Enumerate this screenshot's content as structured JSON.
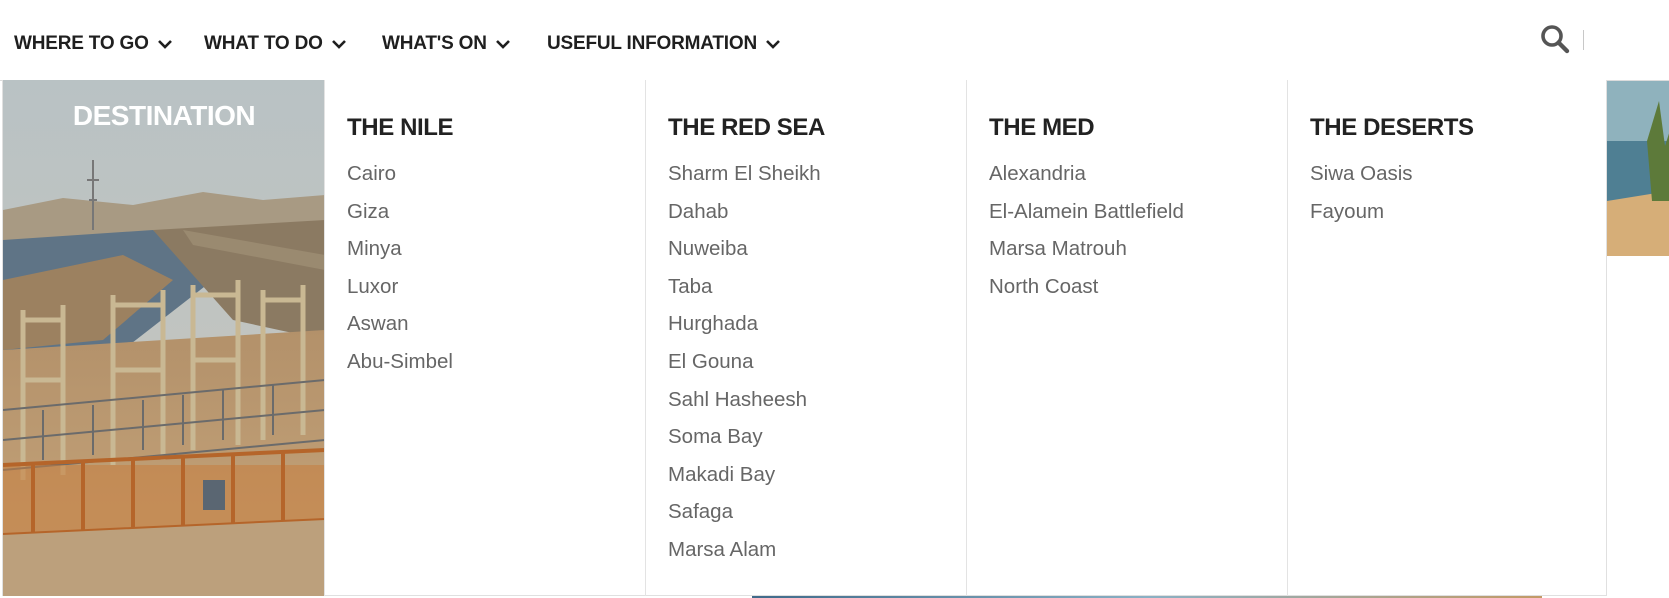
{
  "nav": {
    "items": [
      {
        "label": "WHERE TO GO"
      },
      {
        "label": "WHAT TO DO"
      },
      {
        "label": "WHAT'S ON"
      },
      {
        "label": "USEFUL INFORMATION"
      }
    ],
    "search_icon": "search-icon"
  },
  "menu": {
    "promo": {
      "title": "DESTINATION"
    },
    "columns": [
      {
        "heading": "THE NILE",
        "links": [
          "Cairo",
          "Giza",
          "Minya",
          "Luxor",
          "Aswan",
          "Abu-Simbel"
        ]
      },
      {
        "heading": "THE RED SEA",
        "links": [
          "Sharm El Sheikh",
          "Dahab",
          "Nuweiba",
          "Taba",
          "Hurghada",
          "El Gouna",
          "Sahl Hasheesh",
          "Soma Bay",
          "Makadi Bay",
          "Safaga",
          "Marsa Alam"
        ]
      },
      {
        "heading": "THE MED",
        "links": [
          "Alexandria",
          "El-Alamein Battlefield",
          "Marsa Matrouh",
          "North Coast"
        ]
      },
      {
        "heading": "THE DESERTS",
        "links": [
          "Siwa Oasis",
          "Fayoum"
        ]
      }
    ]
  },
  "colors": {
    "nav_text": "#1f1f1f",
    "link_text": "#666666",
    "heading_text": "#222222"
  }
}
